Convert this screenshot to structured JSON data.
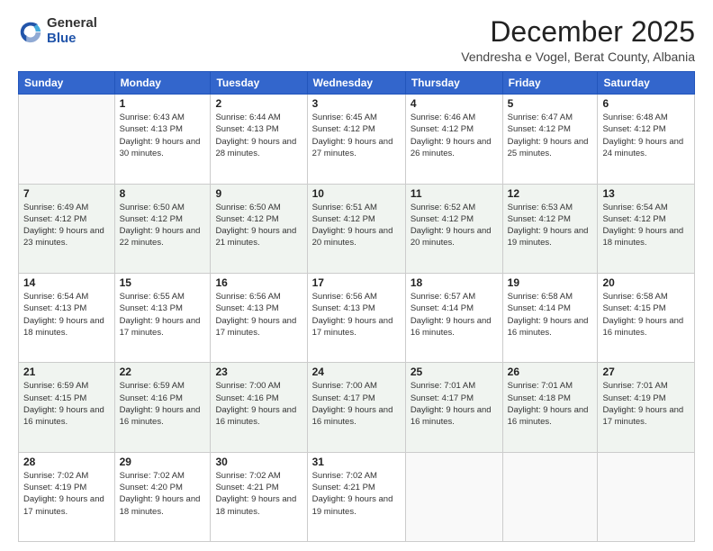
{
  "logo": {
    "general": "General",
    "blue": "Blue"
  },
  "header": {
    "month": "December 2025",
    "location": "Vendresha e Vogel, Berat County, Albania"
  },
  "days_of_week": [
    "Sunday",
    "Monday",
    "Tuesday",
    "Wednesday",
    "Thursday",
    "Friday",
    "Saturday"
  ],
  "weeks": [
    [
      {
        "day": "",
        "sunrise": "",
        "sunset": "",
        "daylight": ""
      },
      {
        "day": "1",
        "sunrise": "6:43 AM",
        "sunset": "4:13 PM",
        "daylight": "9 hours and 30 minutes."
      },
      {
        "day": "2",
        "sunrise": "6:44 AM",
        "sunset": "4:13 PM",
        "daylight": "9 hours and 28 minutes."
      },
      {
        "day": "3",
        "sunrise": "6:45 AM",
        "sunset": "4:12 PM",
        "daylight": "9 hours and 27 minutes."
      },
      {
        "day": "4",
        "sunrise": "6:46 AM",
        "sunset": "4:12 PM",
        "daylight": "9 hours and 26 minutes."
      },
      {
        "day": "5",
        "sunrise": "6:47 AM",
        "sunset": "4:12 PM",
        "daylight": "9 hours and 25 minutes."
      },
      {
        "day": "6",
        "sunrise": "6:48 AM",
        "sunset": "4:12 PM",
        "daylight": "9 hours and 24 minutes."
      }
    ],
    [
      {
        "day": "7",
        "sunrise": "6:49 AM",
        "sunset": "4:12 PM",
        "daylight": "9 hours and 23 minutes."
      },
      {
        "day": "8",
        "sunrise": "6:50 AM",
        "sunset": "4:12 PM",
        "daylight": "9 hours and 22 minutes."
      },
      {
        "day": "9",
        "sunrise": "6:50 AM",
        "sunset": "4:12 PM",
        "daylight": "9 hours and 21 minutes."
      },
      {
        "day": "10",
        "sunrise": "6:51 AM",
        "sunset": "4:12 PM",
        "daylight": "9 hours and 20 minutes."
      },
      {
        "day": "11",
        "sunrise": "6:52 AM",
        "sunset": "4:12 PM",
        "daylight": "9 hours and 20 minutes."
      },
      {
        "day": "12",
        "sunrise": "6:53 AM",
        "sunset": "4:12 PM",
        "daylight": "9 hours and 19 minutes."
      },
      {
        "day": "13",
        "sunrise": "6:54 AM",
        "sunset": "4:12 PM",
        "daylight": "9 hours and 18 minutes."
      }
    ],
    [
      {
        "day": "14",
        "sunrise": "6:54 AM",
        "sunset": "4:13 PM",
        "daylight": "9 hours and 18 minutes."
      },
      {
        "day": "15",
        "sunrise": "6:55 AM",
        "sunset": "4:13 PM",
        "daylight": "9 hours and 17 minutes."
      },
      {
        "day": "16",
        "sunrise": "6:56 AM",
        "sunset": "4:13 PM",
        "daylight": "9 hours and 17 minutes."
      },
      {
        "day": "17",
        "sunrise": "6:56 AM",
        "sunset": "4:13 PM",
        "daylight": "9 hours and 17 minutes."
      },
      {
        "day": "18",
        "sunrise": "6:57 AM",
        "sunset": "4:14 PM",
        "daylight": "9 hours and 16 minutes."
      },
      {
        "day": "19",
        "sunrise": "6:58 AM",
        "sunset": "4:14 PM",
        "daylight": "9 hours and 16 minutes."
      },
      {
        "day": "20",
        "sunrise": "6:58 AM",
        "sunset": "4:15 PM",
        "daylight": "9 hours and 16 minutes."
      }
    ],
    [
      {
        "day": "21",
        "sunrise": "6:59 AM",
        "sunset": "4:15 PM",
        "daylight": "9 hours and 16 minutes."
      },
      {
        "day": "22",
        "sunrise": "6:59 AM",
        "sunset": "4:16 PM",
        "daylight": "9 hours and 16 minutes."
      },
      {
        "day": "23",
        "sunrise": "7:00 AM",
        "sunset": "4:16 PM",
        "daylight": "9 hours and 16 minutes."
      },
      {
        "day": "24",
        "sunrise": "7:00 AM",
        "sunset": "4:17 PM",
        "daylight": "9 hours and 16 minutes."
      },
      {
        "day": "25",
        "sunrise": "7:01 AM",
        "sunset": "4:17 PM",
        "daylight": "9 hours and 16 minutes."
      },
      {
        "day": "26",
        "sunrise": "7:01 AM",
        "sunset": "4:18 PM",
        "daylight": "9 hours and 16 minutes."
      },
      {
        "day": "27",
        "sunrise": "7:01 AM",
        "sunset": "4:19 PM",
        "daylight": "9 hours and 17 minutes."
      }
    ],
    [
      {
        "day": "28",
        "sunrise": "7:02 AM",
        "sunset": "4:19 PM",
        "daylight": "9 hours and 17 minutes."
      },
      {
        "day": "29",
        "sunrise": "7:02 AM",
        "sunset": "4:20 PM",
        "daylight": "9 hours and 18 minutes."
      },
      {
        "day": "30",
        "sunrise": "7:02 AM",
        "sunset": "4:21 PM",
        "daylight": "9 hours and 18 minutes."
      },
      {
        "day": "31",
        "sunrise": "7:02 AM",
        "sunset": "4:21 PM",
        "daylight": "9 hours and 19 minutes."
      },
      {
        "day": "",
        "sunrise": "",
        "sunset": "",
        "daylight": ""
      },
      {
        "day": "",
        "sunrise": "",
        "sunset": "",
        "daylight": ""
      },
      {
        "day": "",
        "sunrise": "",
        "sunset": "",
        "daylight": ""
      }
    ]
  ],
  "labels": {
    "sunrise_prefix": "Sunrise: ",
    "sunset_prefix": "Sunset: ",
    "daylight_prefix": "Daylight: "
  }
}
